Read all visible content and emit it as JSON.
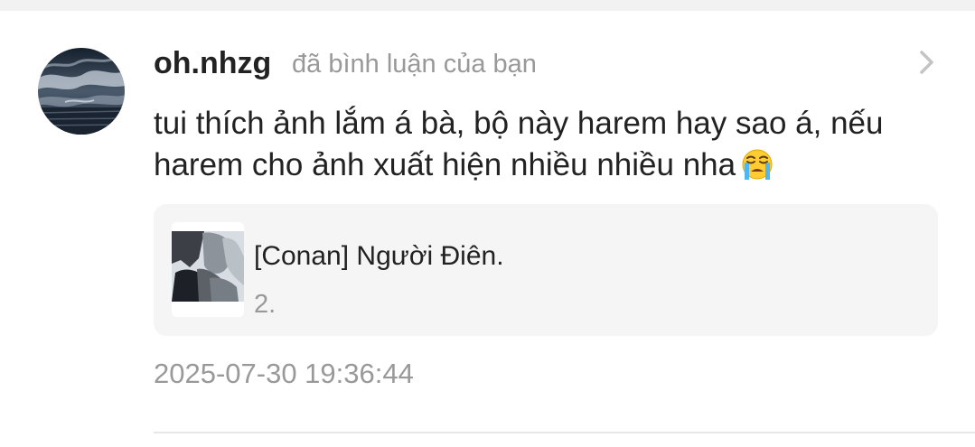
{
  "notification": {
    "username": "oh.nhzg",
    "action_text": "đã bình luận của bạn",
    "comment_text": "tui thích ảnh lắm á bà, bộ này harem hay sao á, nếu harem cho ảnh xuất hiện nhiều nhiều nha",
    "comment_emoji": "loudly-crying-face-emoji",
    "story": {
      "title": "[Conan] Người Điên.",
      "chapter": "2."
    },
    "timestamp": "2025-07-30 19:36:44"
  },
  "icons": {
    "open": "chevron-right-icon"
  },
  "colors": {
    "primary_text": "#222222",
    "secondary_text": "#999999",
    "card_background": "#f5f5f5",
    "divider": "#e6e6e6"
  }
}
